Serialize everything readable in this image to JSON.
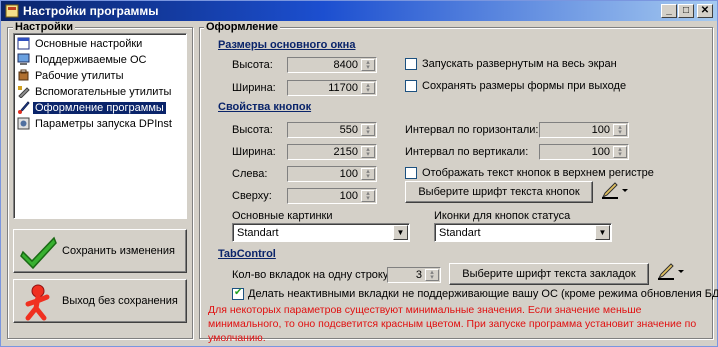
{
  "window": {
    "title": "Настройки программы",
    "min": "_",
    "max": "□",
    "close": "✕"
  },
  "sidebar": {
    "title": "Настройки",
    "items": [
      {
        "label": "Основные настройки",
        "icon": "settings-window-icon"
      },
      {
        "label": "Поддерживаемые ОС",
        "icon": "computer-icon"
      },
      {
        "label": "Рабочие утилиты",
        "icon": "tools-icon"
      },
      {
        "label": "Вспомогательные утилиты",
        "icon": "wrench-icon"
      },
      {
        "label": "Оформление программы",
        "icon": "brush-icon",
        "selected": true
      },
      {
        "label": "Параметры запуска DPInst",
        "icon": "gear-grid-icon"
      }
    ],
    "save_label": "Сохранить изменения",
    "exit_label": "Выход без сохранения"
  },
  "main": {
    "group_title": "Оформление",
    "window_size": {
      "title": "Размеры основного окна",
      "height_label": "Высота:",
      "height_value": "8400",
      "width_label": "Ширина:",
      "width_value": "11700",
      "maximize_label": "Запускать развернутым на весь экран",
      "maximize_checked": false,
      "save_size_label": "Сохранять размеры формы при выходе",
      "save_size_checked": false
    },
    "buttons_props": {
      "title": "Свойства кнопок",
      "height_label": "Высота:",
      "height_value": "550",
      "width_label": "Ширина:",
      "width_value": "2150",
      "left_label": "Слева:",
      "left_value": "100",
      "top_label": "Сверху:",
      "top_value": "100",
      "h_interval_label": "Интервал по горизонтали:",
      "h_interval_value": "100",
      "v_interval_label": "Интервал по вертикали:",
      "v_interval_value": "100",
      "uppercase_label": "Отображать текст кнопок в верхнем регистре",
      "uppercase_checked": false,
      "font_button_label": "Выберите шрифт текста кнопок"
    },
    "images": {
      "main_label": "Основные картинки",
      "main_value": "Standart",
      "status_label": "Иконки для кнопок статуса",
      "status_value": "Standart"
    },
    "tabcontrol": {
      "title": "TabControl",
      "per_row_label": "Кол-во вкладок на одну строку:",
      "per_row_value": "3",
      "font_button_label": "Выберите шрифт текста закладок",
      "inactive_label": "Делать неактивными вкладки не поддерживающие вашу ОС (кроме режима обновления БД)",
      "inactive_checked": true
    },
    "warning": "Для некоторых параметров существуют минимальные значения. Если значение меньше минимального, то оно подсветится красным цветом. При запуске программа установит значение по умолчанию."
  }
}
